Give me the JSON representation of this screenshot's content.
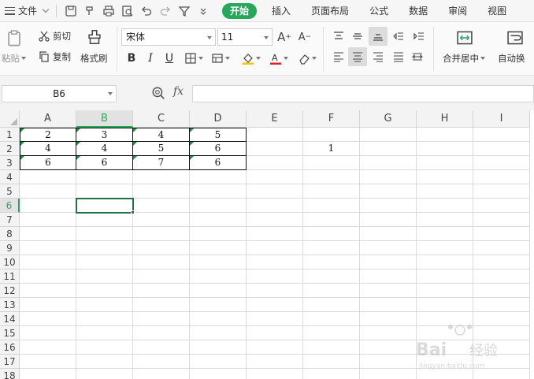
{
  "menubar": {
    "file_label": "文件",
    "tabs": [
      {
        "label": "开始",
        "active": true
      },
      {
        "label": "插入",
        "active": false
      },
      {
        "label": "页面布局",
        "active": false
      },
      {
        "label": "公式",
        "active": false
      },
      {
        "label": "数据",
        "active": false
      },
      {
        "label": "审阅",
        "active": false
      },
      {
        "label": "视图",
        "active": false
      }
    ],
    "quick_access_icons": [
      "save-icon",
      "format-painter-icon",
      "print-icon",
      "print-preview-icon",
      "undo-icon",
      "redo-icon",
      "filter-icon",
      "more-icon"
    ]
  },
  "ribbon": {
    "paste_label": "粘贴",
    "cut_label": "剪切",
    "copy_label": "复制",
    "format_brush_label": "格式刷",
    "font_name": "宋体",
    "font_size": "11",
    "merge_center_label": "合并居中",
    "auto_wrap_label": "自动换",
    "accent_color": "#25a85a",
    "fill_color": "#f5c400",
    "font_color": "#e02020"
  },
  "formula_bar": {
    "name_box": "B6",
    "fx_label": "fx",
    "formula": ""
  },
  "sheet": {
    "columns": [
      "A",
      "B",
      "C",
      "D",
      "E",
      "F",
      "G",
      "H",
      "I"
    ],
    "rows": [
      "1",
      "2",
      "3",
      "4",
      "5",
      "6",
      "7",
      "8",
      "9",
      "10",
      "11",
      "12",
      "13",
      "14",
      "15",
      "16",
      "17",
      "18"
    ],
    "active_column": "B",
    "active_row": "6",
    "cells": {
      "A1": "2",
      "B1": "3",
      "C1": "4",
      "D1": "5",
      "A2": "4",
      "B2": "4",
      "C2": "5",
      "D2": "6",
      "F2": "1",
      "A3": "6",
      "B3": "6",
      "C3": "7",
      "D3": "6"
    }
  },
  "watermark": {
    "brand": "Bai",
    "brand_suffix": "经验",
    "url": "jingyan.baidu.com"
  }
}
